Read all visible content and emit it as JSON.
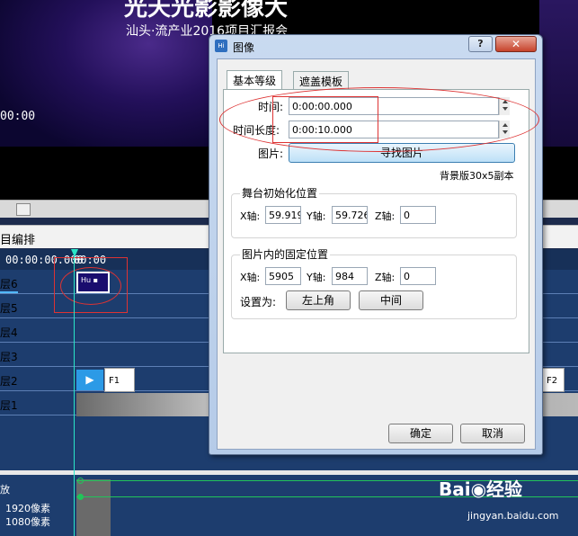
{
  "preview": {
    "title": "光天光影影像大",
    "subtitle": "汕头·流产业2016项目汇报会",
    "timecode": "00:00"
  },
  "section": {
    "label": "目编排"
  },
  "timeline": {
    "ruler_time": "00:00:00.000",
    "ruler_time_tail": "00:00",
    "tracks": [
      "层6",
      "层5",
      "层4",
      "层3",
      "层2",
      "层1"
    ],
    "clip_label": "Hu ▪",
    "f1": "F1",
    "f2": "F2"
  },
  "lower": {
    "label": "放",
    "width": "1920像素",
    "height": "1080像素"
  },
  "watermark": {
    "brand": "Bai◉经验",
    "url": "jingyan.baidu.com"
  },
  "dialog": {
    "title": "图像",
    "help": "?",
    "close": "✕",
    "tabs": [
      "基本等级",
      "遮盖模板"
    ],
    "time_label": "时间:",
    "time_value": "0:00:00.000",
    "duration_label": "时间长度:",
    "duration_value": "0:00:10.000",
    "image_label": "图片:",
    "find_image": "寻找图片",
    "image_name": "背景版30x5副本",
    "stage_group": "舞台初始化位置",
    "stage_x_label": "X轴:",
    "stage_x": "59.919",
    "stage_y_label": "Y轴:",
    "stage_y": "59.726",
    "stage_z_label": "Z轴:",
    "stage_z": "0",
    "anchor_group": "图片内的固定位置",
    "anchor_x_label": "X轴:",
    "anchor_x": "5905",
    "anchor_y_label": "Y轴:",
    "anchor_y": "984",
    "anchor_z_label": "Z轴:",
    "anchor_z": "0",
    "set_as_label": "设置为:",
    "top_left": "左上角",
    "center": "中间",
    "ok": "确定",
    "cancel": "取消"
  }
}
